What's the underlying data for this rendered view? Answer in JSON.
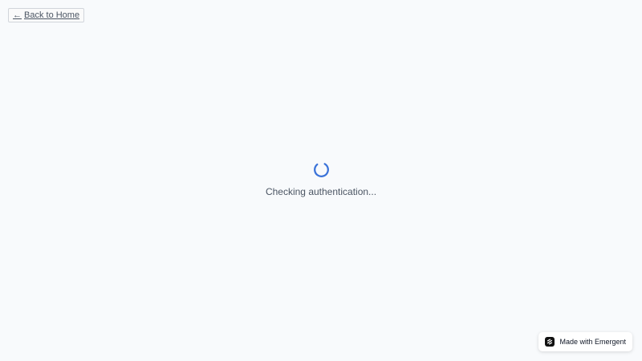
{
  "nav": {
    "back_arrow": "←",
    "back_label": "Back to Home"
  },
  "status": {
    "message": "Checking authentication...",
    "spinner_icon": "loading-spinner-icon",
    "spinner_color": "#3b73d9"
  },
  "badge": {
    "label": "Made with Emergent",
    "logo_icon": "emergent-logo-icon"
  },
  "colors": {
    "background": "#f8fafc",
    "text": "#4b5563"
  }
}
